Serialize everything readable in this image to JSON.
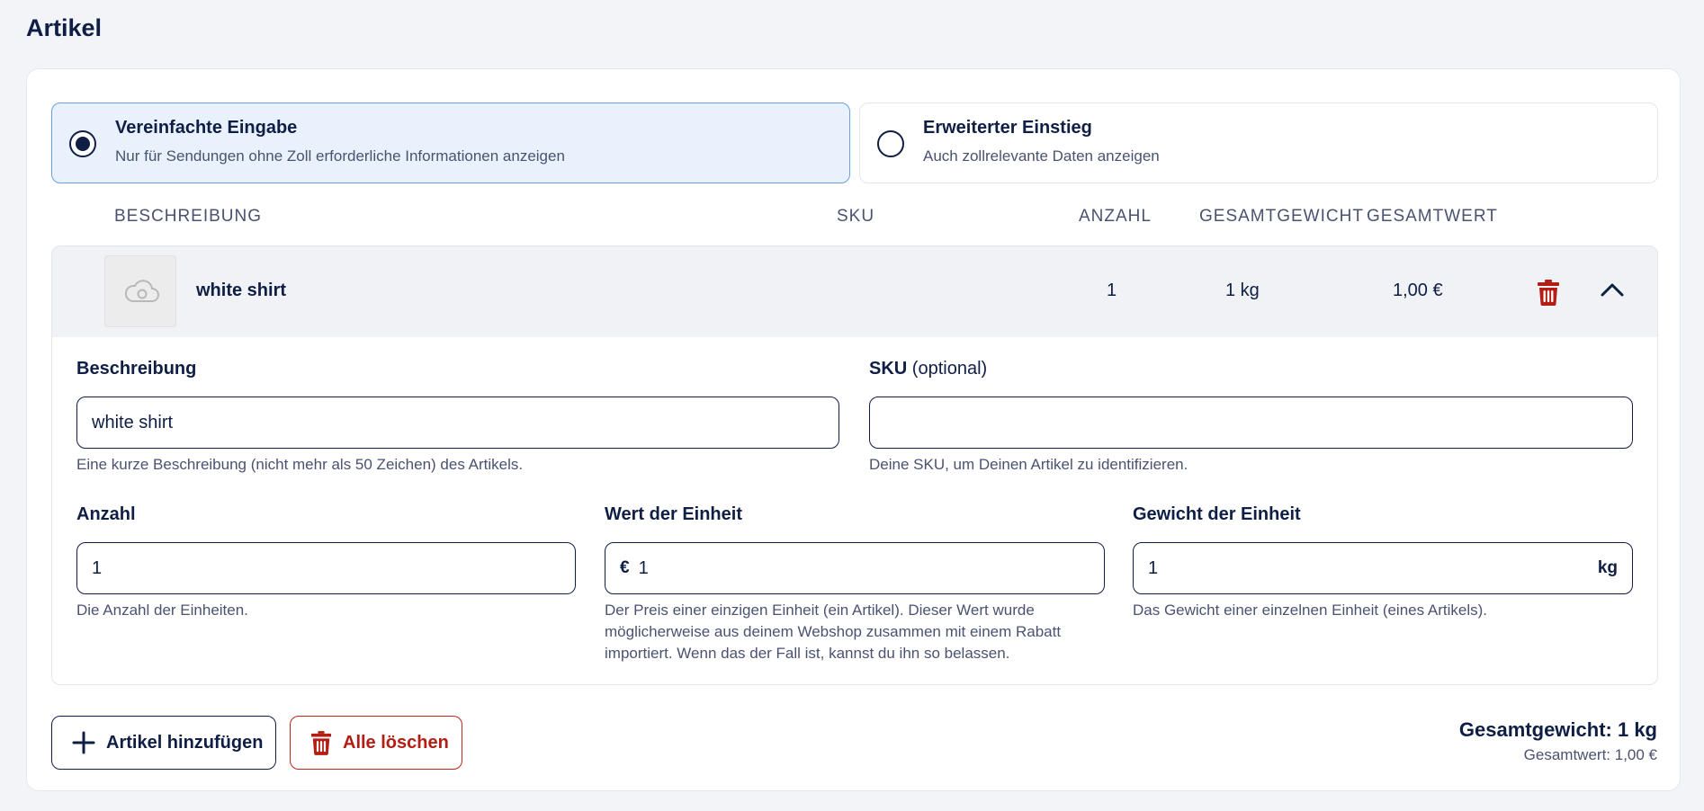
{
  "section": {
    "title": "Artikel"
  },
  "modes": [
    {
      "title": "Vereinfachte Eingabe",
      "description": "Nur für Sendungen ohne Zoll erforderliche Informationen anzeigen",
      "selected": true
    },
    {
      "title": "Erweiterter Einstieg",
      "description": "Auch zollrelevante Daten anzeigen",
      "selected": false
    }
  ],
  "table": {
    "headers": {
      "description": "BESCHREIBUNG",
      "sku": "SKU",
      "quantity": "ANZAHL",
      "total_weight": "GESAMTGEWICHT",
      "total_value": "GESAMTWERT"
    },
    "rows": [
      {
        "name": "white shirt",
        "sku": "",
        "quantity": "1",
        "weight": "1 kg",
        "value": "1,00 €",
        "thumbnail_icon": "cloud-icon"
      }
    ]
  },
  "form": {
    "description": {
      "label": "Beschreibung",
      "value": "white shirt",
      "help": "Eine kurze Beschreibung (nicht mehr als 50 Zeichen) des Artikels."
    },
    "sku": {
      "label": "SKU",
      "label_optional": "(optional)",
      "value": "",
      "help": "Deine SKU, um Deinen Artikel zu identifizieren."
    },
    "quantity": {
      "label": "Anzahl",
      "value": "1",
      "help": "Die Anzahl der Einheiten."
    },
    "unit_value": {
      "label": "Wert der Einheit",
      "prefix": "€",
      "value": "1",
      "help": "Der Preis einer einzigen Einheit (ein Artikel). Dieser Wert wurde möglicherweise aus deinem Webshop zusammen mit einem Rabatt importiert. Wenn das der Fall ist, kannst du ihn so belassen."
    },
    "unit_weight": {
      "label": "Gewicht der Einheit",
      "value": "1",
      "suffix": "kg",
      "help": "Das Gewicht einer einzelnen Einheit (eines Artikels)."
    }
  },
  "actions": {
    "add_label": "Artikel hinzufügen",
    "delete_all_label": "Alle löschen"
  },
  "totals": {
    "weight": "Gesamtgewicht: 1 kg",
    "value": "Gesamtwert: 1,00 €"
  },
  "colors": {
    "primary": "#0f1e45",
    "danger": "#b31d14",
    "selected_bg": "#e9f1fd",
    "selected_border": "#6a9ee6"
  }
}
